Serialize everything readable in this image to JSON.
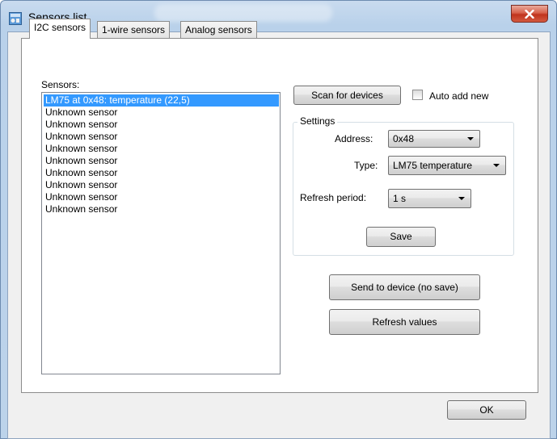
{
  "window": {
    "title": "Sensors list",
    "close_glyph": "✕"
  },
  "tabs": [
    {
      "label": "I2C sensors",
      "active": true
    },
    {
      "label": "1-wire sensors",
      "active": false
    },
    {
      "label": "Analog sensors",
      "active": false
    }
  ],
  "sensors": {
    "label": "Sensors:",
    "items": [
      {
        "label": "LM75 at 0x48: temperature (22,5)",
        "selected": true
      },
      {
        "label": "Unknown sensor"
      },
      {
        "label": "Unknown sensor"
      },
      {
        "label": "Unknown sensor"
      },
      {
        "label": "Unknown sensor"
      },
      {
        "label": "Unknown sensor"
      },
      {
        "label": "Unknown sensor"
      },
      {
        "label": "Unknown sensor"
      },
      {
        "label": "Unknown sensor"
      },
      {
        "label": "Unknown sensor"
      }
    ]
  },
  "scan": {
    "label": "Scan for devices"
  },
  "auto_add": {
    "label": "Auto add new",
    "checked": false
  },
  "settings": {
    "title": "Settings",
    "address_label": "Address:",
    "address_value": "0x48",
    "type_label": "Type:",
    "type_value": "LM75 temperature",
    "refresh_label": "Refresh period:",
    "refresh_value": "1 s",
    "save_label": "Save"
  },
  "actions": {
    "send_label": "Send to device (no save)",
    "refresh_label": "Refresh values"
  },
  "ok_label": "OK",
  "colors": {
    "selection": "#3399ff",
    "close_button": "#c0331d",
    "title_bar": "#b9d1ea"
  },
  "icons": {
    "title": "sensor-app-icon",
    "close": "close-icon"
  }
}
